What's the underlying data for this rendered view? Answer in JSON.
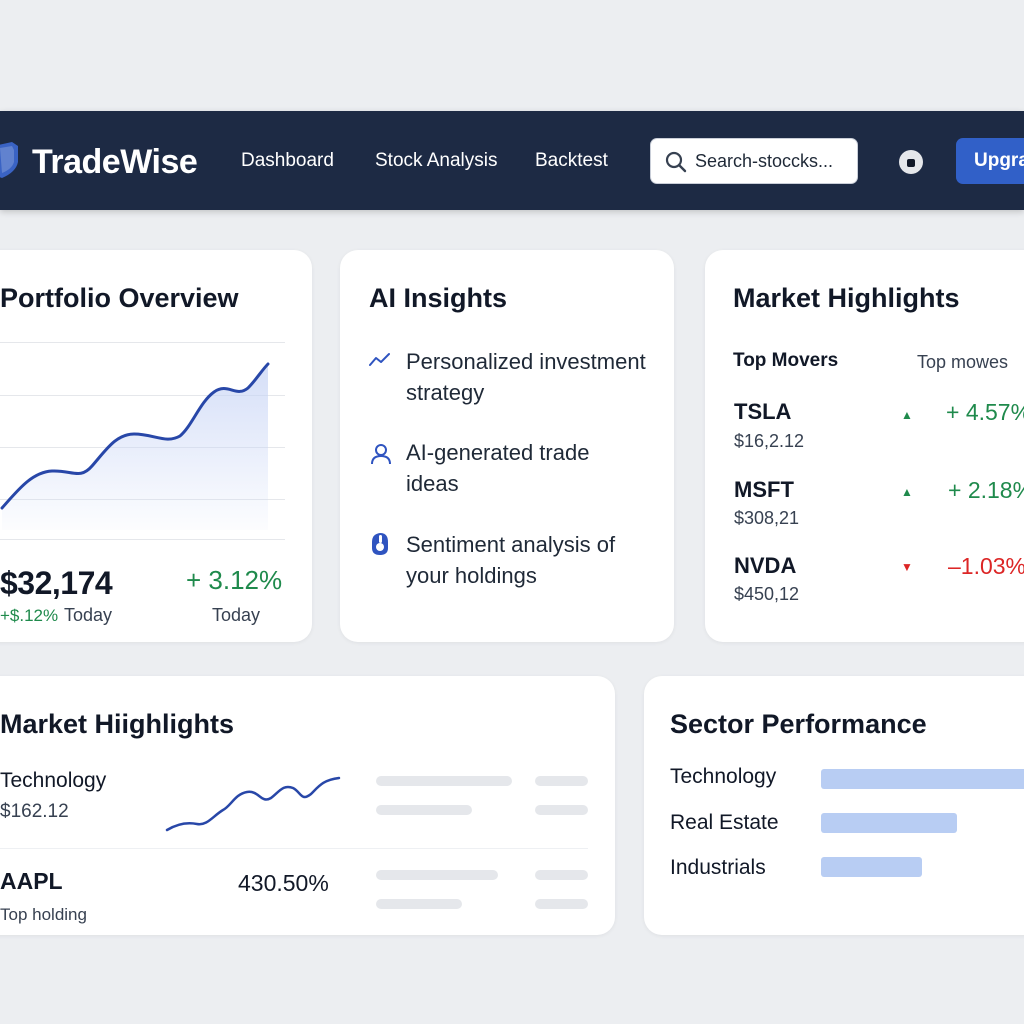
{
  "header": {
    "brand": "TradeWise",
    "nav": [
      "Dashboard",
      "Stock Analysis",
      "Backtest"
    ],
    "search_placeholder": "Search-stoccks...",
    "upgrade_label": "Upgra"
  },
  "portfolio": {
    "title": "Portfolio Overview",
    "value": "$32,174",
    "change_small": "+$.12%",
    "change_small_label": "Today",
    "change_pct": "+ 3.12%",
    "change_pct_label": "Today"
  },
  "insights": {
    "title": "AI Insights",
    "items": [
      {
        "icon": "trend-icon",
        "text": "Personalized investment strategy"
      },
      {
        "icon": "user-icon",
        "text": "AI-generated trade ideas"
      },
      {
        "icon": "sentiment-icon",
        "text": "Sentiment analysis of your holdings"
      }
    ]
  },
  "market_highlights": {
    "title": "Market Highlights",
    "col1": "Top Movers",
    "col2": "Top mowes",
    "movers": [
      {
        "ticker": "TSLA",
        "price": "$16,2.12",
        "change": "+ 4.57%",
        "direction": "up"
      },
      {
        "ticker": "MSFT",
        "price": "$308,21",
        "change": "+ 2.18%",
        "direction": "up"
      },
      {
        "ticker": "NVDA",
        "price": "$450,12",
        "change": "–1.03%",
        "direction": "down"
      }
    ]
  },
  "market_highlights_2": {
    "title": "Market Hiighlights",
    "row1_name": "Technology",
    "row1_price": "$162.12",
    "row2_name": "AAPL",
    "row2_sub": "Top holding",
    "row2_value": "430.50%"
  },
  "sector": {
    "title": "Sector Performance",
    "items": [
      "Technology",
      "Real Estate",
      "Industrials"
    ]
  },
  "colors": {
    "header_bg": "#1d2a44",
    "accent": "#3160c8",
    "positive": "#1f8a4c",
    "negative": "#dc2626",
    "line": "#2847a8"
  }
}
